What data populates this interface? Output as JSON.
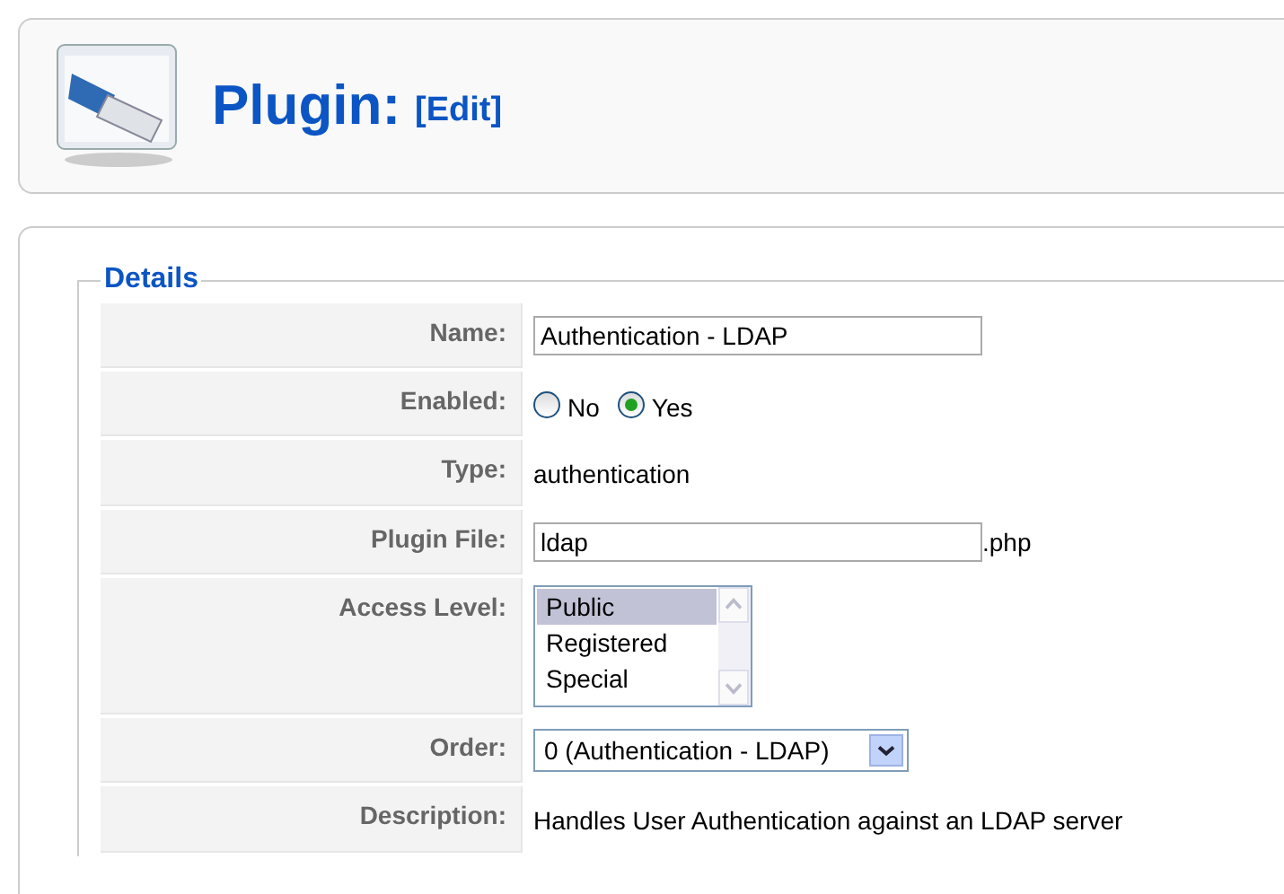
{
  "header": {
    "title": "Plugin:",
    "subtitle": "[Edit]"
  },
  "details": {
    "legend": "Details",
    "rows": [
      {
        "kind": "input",
        "label": "Name:",
        "value": "Authentication - LDAP"
      },
      {
        "kind": "radio",
        "label": "Enabled:",
        "options": [
          {
            "label": "No",
            "selected": false
          },
          {
            "label": "Yes",
            "selected": true
          }
        ]
      },
      {
        "kind": "static",
        "label": "Type:",
        "value": "authentication"
      },
      {
        "kind": "input",
        "label": "Plugin File:",
        "value": "ldap",
        "suffix": ".php"
      },
      {
        "kind": "listbox",
        "label": "Access Level:",
        "options": [
          {
            "label": "Public",
            "selected": true
          },
          {
            "label": "Registered",
            "selected": false
          },
          {
            "label": "Special",
            "selected": false
          }
        ]
      },
      {
        "kind": "select",
        "label": "Order:",
        "value": "0 (Authentication - LDAP)"
      },
      {
        "kind": "static",
        "label": "Description:",
        "value": "Handles User Authentication against an LDAP server"
      }
    ]
  }
}
